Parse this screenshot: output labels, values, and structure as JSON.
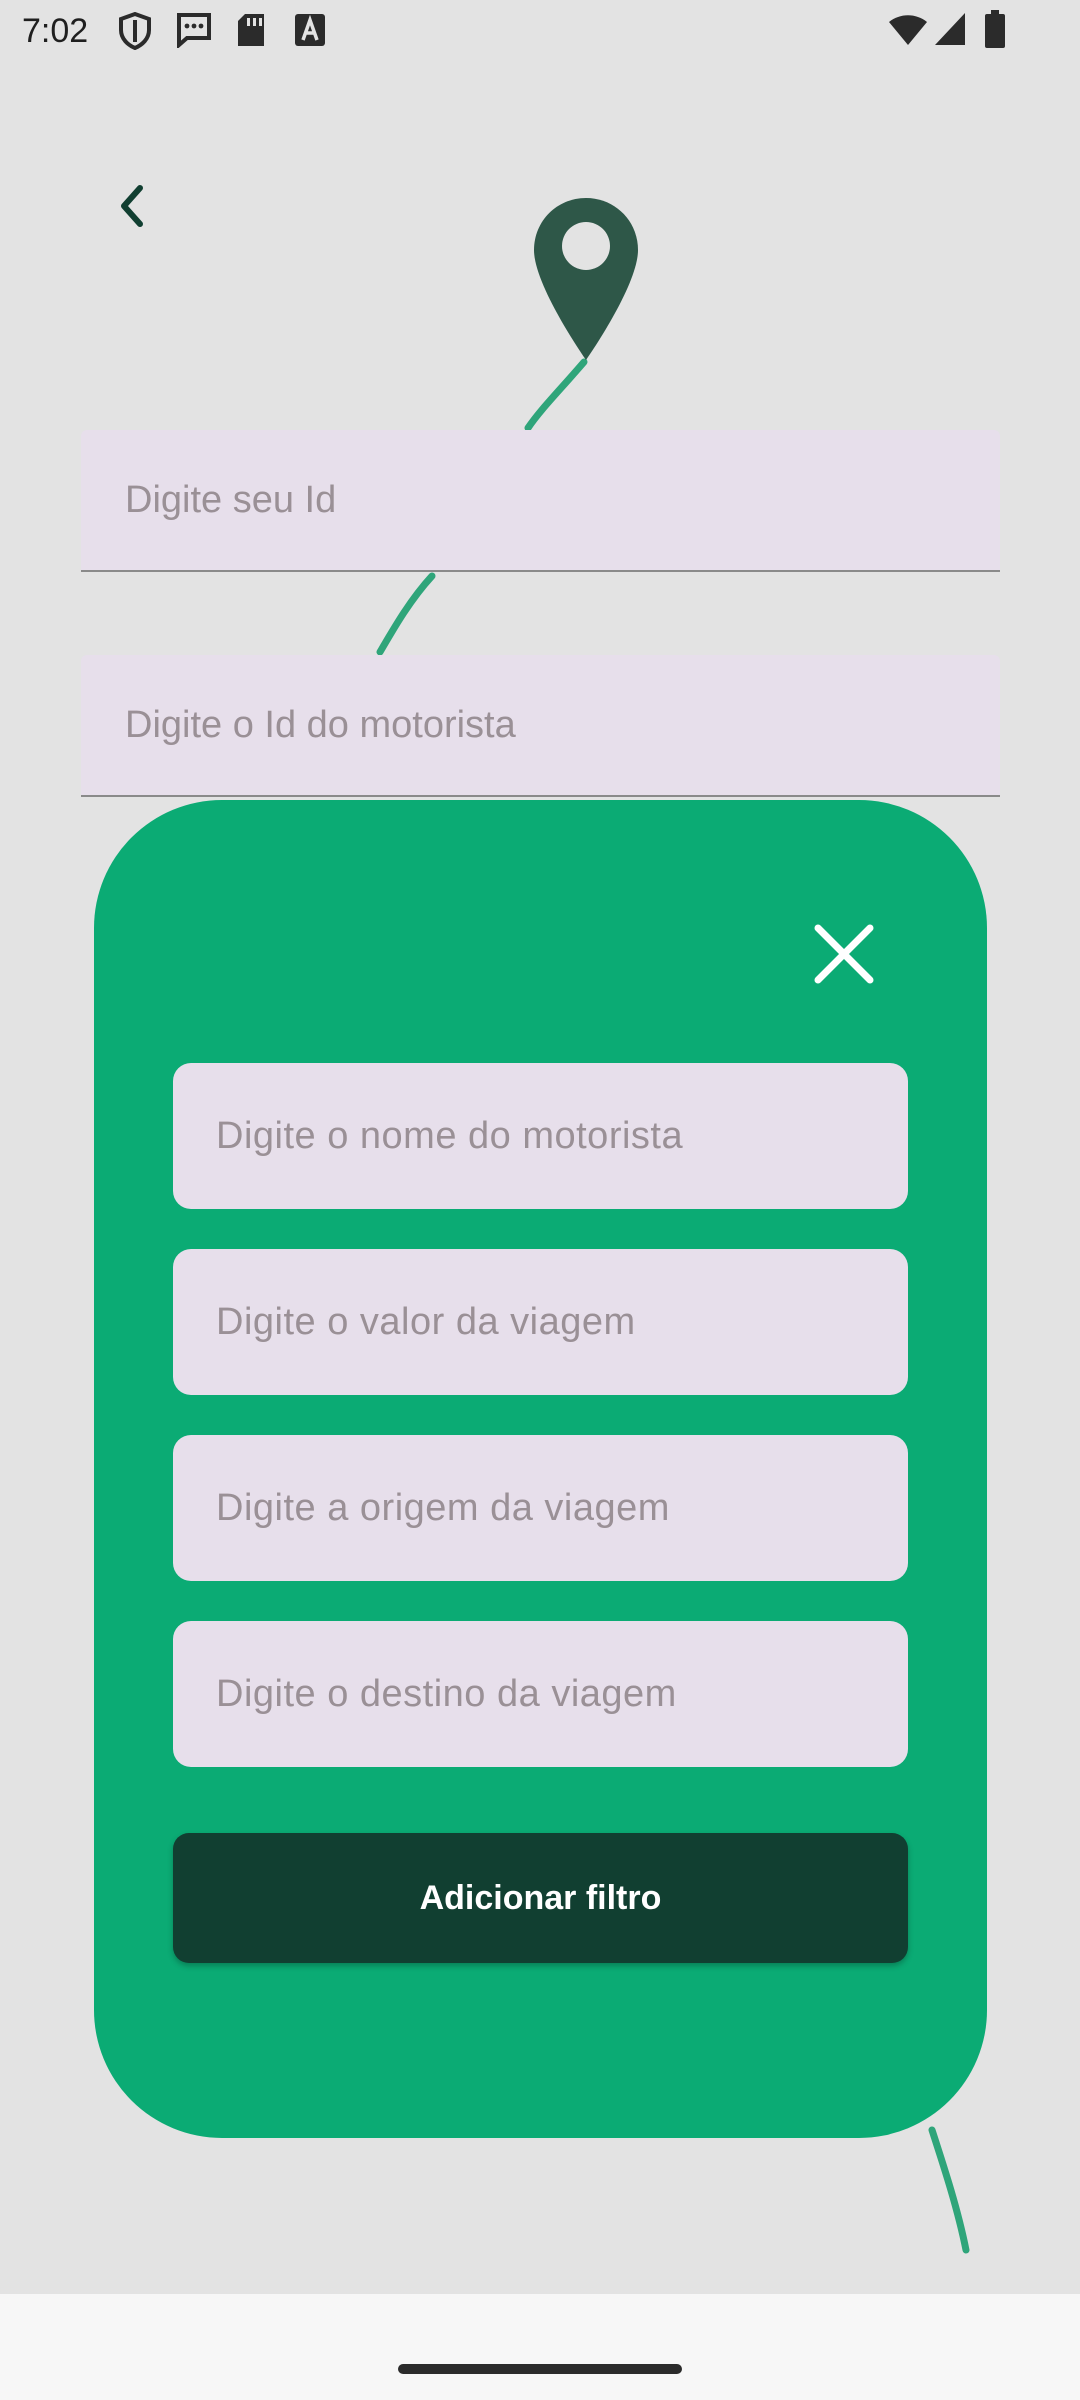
{
  "status_bar": {
    "time": "7:02",
    "icons_left": [
      "shield-icon",
      "message-icon",
      "sd-card-icon",
      "font-a-icon"
    ],
    "icons_right": [
      "wifi-icon",
      "signal-icon",
      "battery-icon"
    ]
  },
  "form": {
    "user_id_placeholder": "Digite seu Id",
    "driver_id_placeholder": "Digite o Id do motorista"
  },
  "filter_modal": {
    "driver_name_placeholder": "Digite o nome do motorista",
    "trip_value_placeholder": "Digite o valor da viagem",
    "trip_origin_placeholder": "Digite a origem da viagem",
    "trip_destination_placeholder": "Digite o destino da viagem",
    "add_filter_label": "Adicionar filtro"
  },
  "colors": {
    "modal_bg": "#0bab74",
    "button_bg": "#113f31",
    "field_bg": "#e7dfeb",
    "route_line": "#2fa57a",
    "pin": "#1e4b3b"
  }
}
